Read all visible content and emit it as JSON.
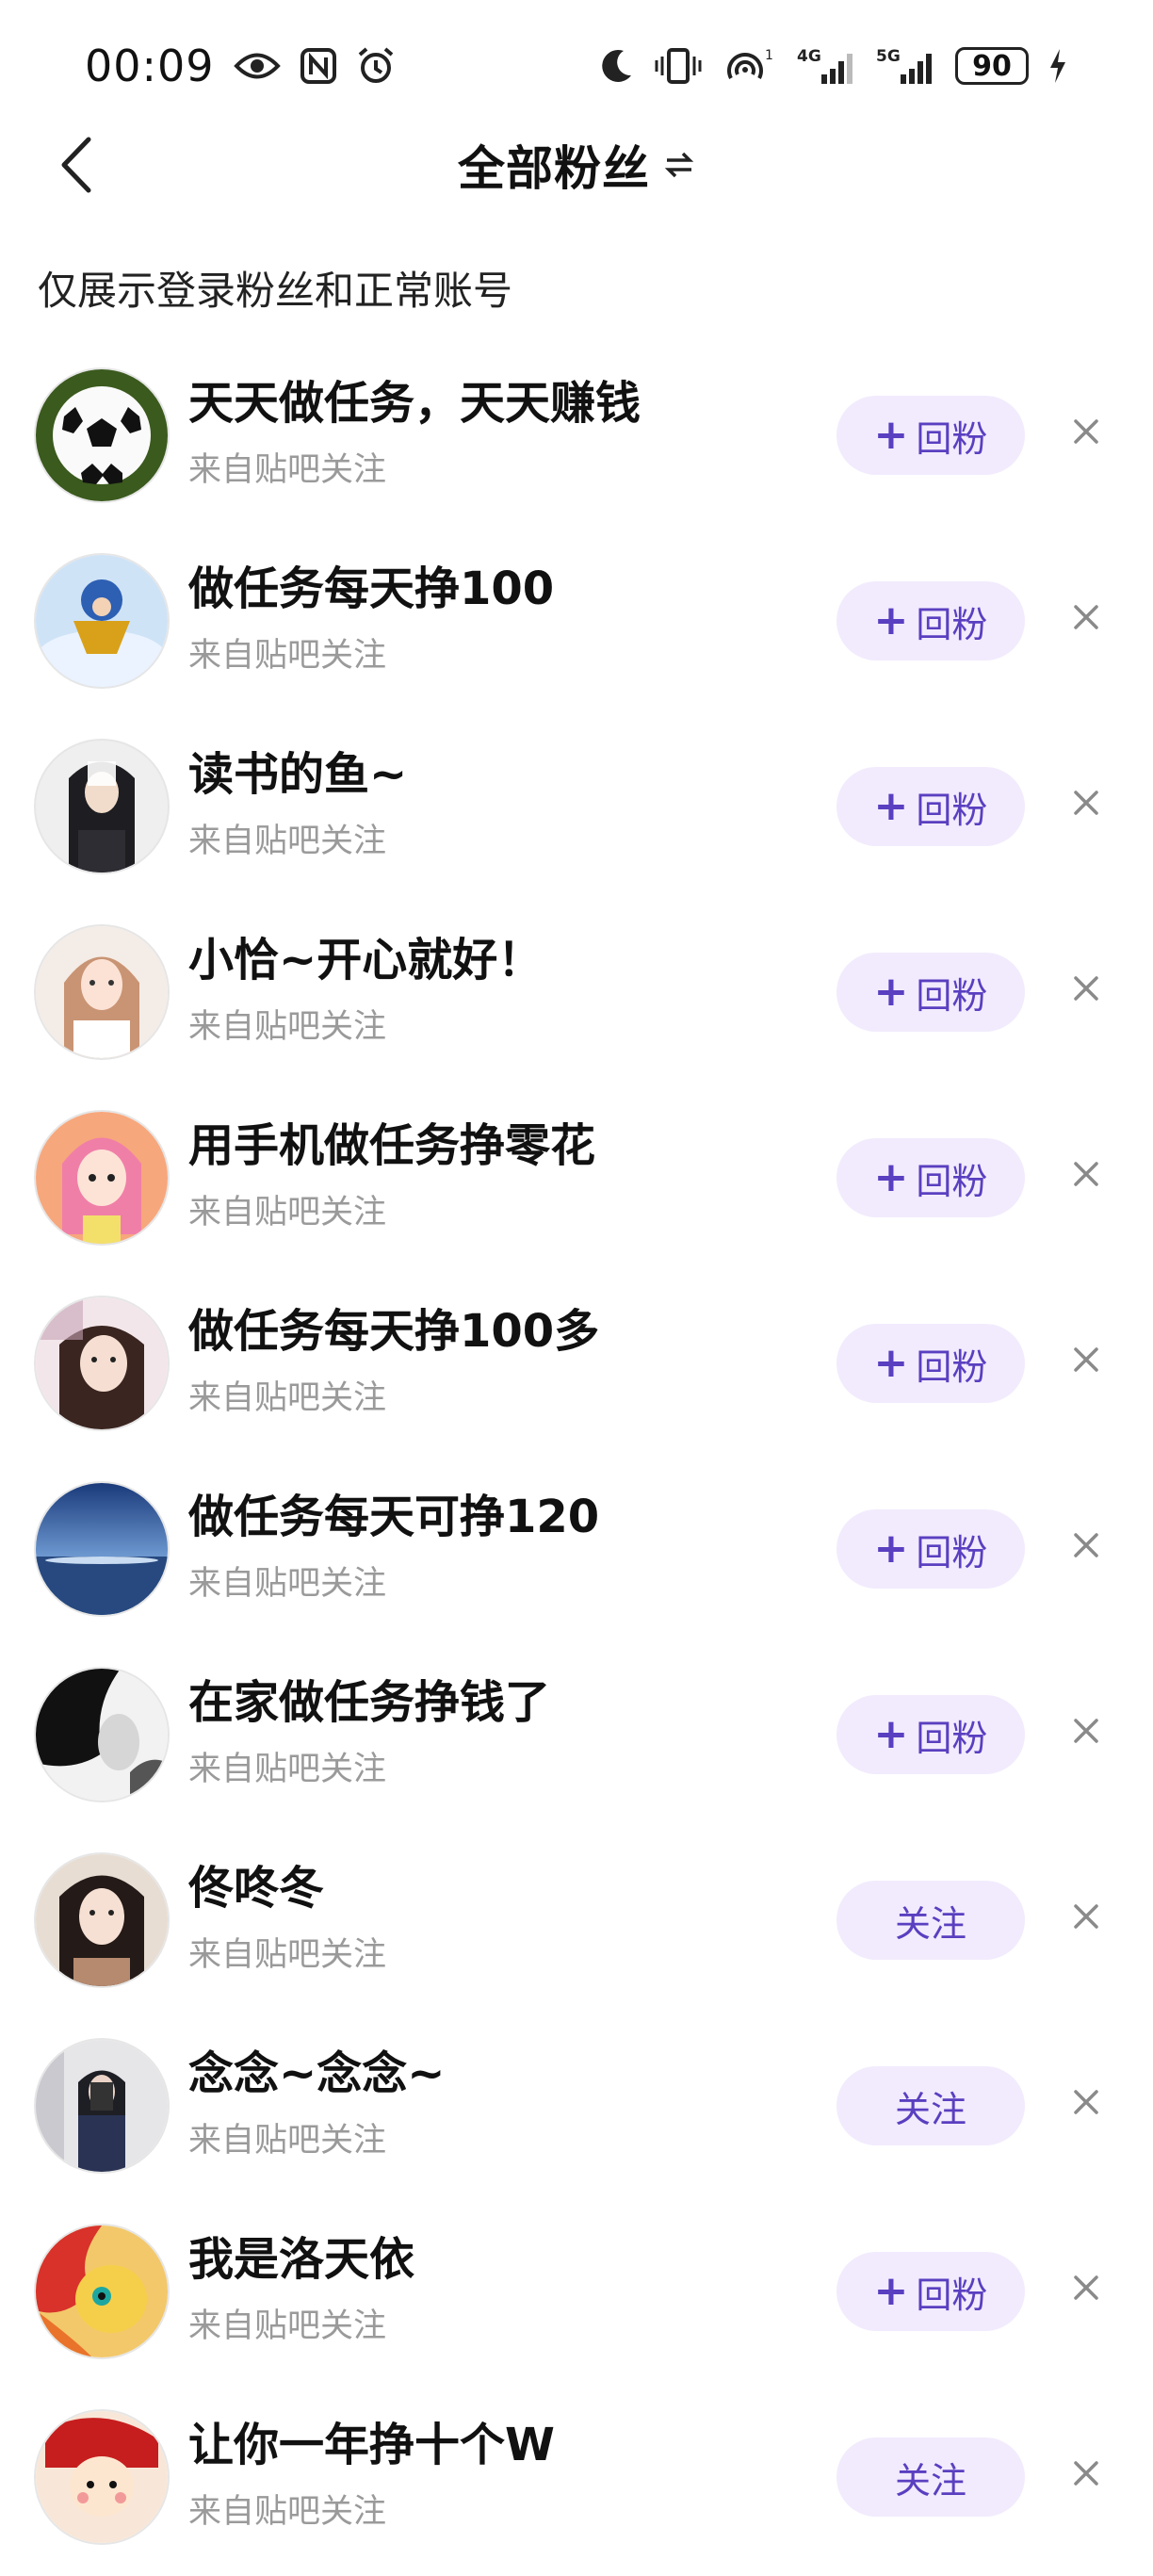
{
  "status_bar": {
    "time": "00:09",
    "battery": "90",
    "net1": "4G",
    "net2": "5G",
    "icons_left": [
      "eye-icon",
      "nfc-icon",
      "alarm-icon"
    ],
    "icons_right": [
      "moon-icon",
      "vibrate-icon",
      "hotspot-icon",
      "signal-icon",
      "signal-icon",
      "battery-icon",
      "charging-icon"
    ]
  },
  "header": {
    "title": "全部粉丝",
    "switch_icon": "swap-arrows-icon"
  },
  "notice": "仅展示登录粉丝和正常账号",
  "followers": [
    {
      "name": "天天做任务，天天赚钱",
      "source": "来自贴吧关注",
      "action": "回粉",
      "plus": true,
      "avatar": "soccer-ball"
    },
    {
      "name": "做任务每天挣100",
      "source": "来自贴吧关注",
      "action": "回粉",
      "plus": true,
      "avatar": "anime-figure-sky"
    },
    {
      "name": "读书的鱼~",
      "source": "来自贴吧关注",
      "action": "回粉",
      "plus": true,
      "avatar": "selfie-girl-dark"
    },
    {
      "name": "小恰~开心就好！",
      "source": "来自贴吧关注",
      "action": "回粉",
      "plus": true,
      "avatar": "girl-light"
    },
    {
      "name": "用手机做任务挣零花",
      "source": "来自贴吧关注",
      "action": "回粉",
      "plus": true,
      "avatar": "anime-girl-pink-hair"
    },
    {
      "name": "做任务每天挣100多",
      "source": "来自贴吧关注",
      "action": "回粉",
      "plus": true,
      "avatar": "girl-selfie"
    },
    {
      "name": "做任务每天可挣120",
      "source": "来自贴吧关注",
      "action": "回粉",
      "plus": true,
      "avatar": "sea-sky"
    },
    {
      "name": "在家做任务挣钱了",
      "source": "来自贴吧关注",
      "action": "回粉",
      "plus": true,
      "avatar": "bw-portrait"
    },
    {
      "name": "佟咚冬",
      "source": "来自贴吧关注",
      "action": "关注",
      "plus": false,
      "avatar": "girl-portrait"
    },
    {
      "name": "念念~念念~",
      "source": "来自贴吧关注",
      "action": "关注",
      "plus": false,
      "avatar": "mirror-selfie"
    },
    {
      "name": "我是洛天依",
      "source": "来自贴吧关注",
      "action": "回粉",
      "plus": true,
      "avatar": "pony-cartoon"
    },
    {
      "name": "让你一年挣十个W",
      "source": "来自贴吧关注",
      "action": "关注",
      "plus": false,
      "avatar": "cartoon-red"
    }
  ],
  "colors": {
    "button_bg": "#f2ebfd",
    "button_text": "#5a3fc0",
    "secondary_text": "#9a9a9a"
  }
}
